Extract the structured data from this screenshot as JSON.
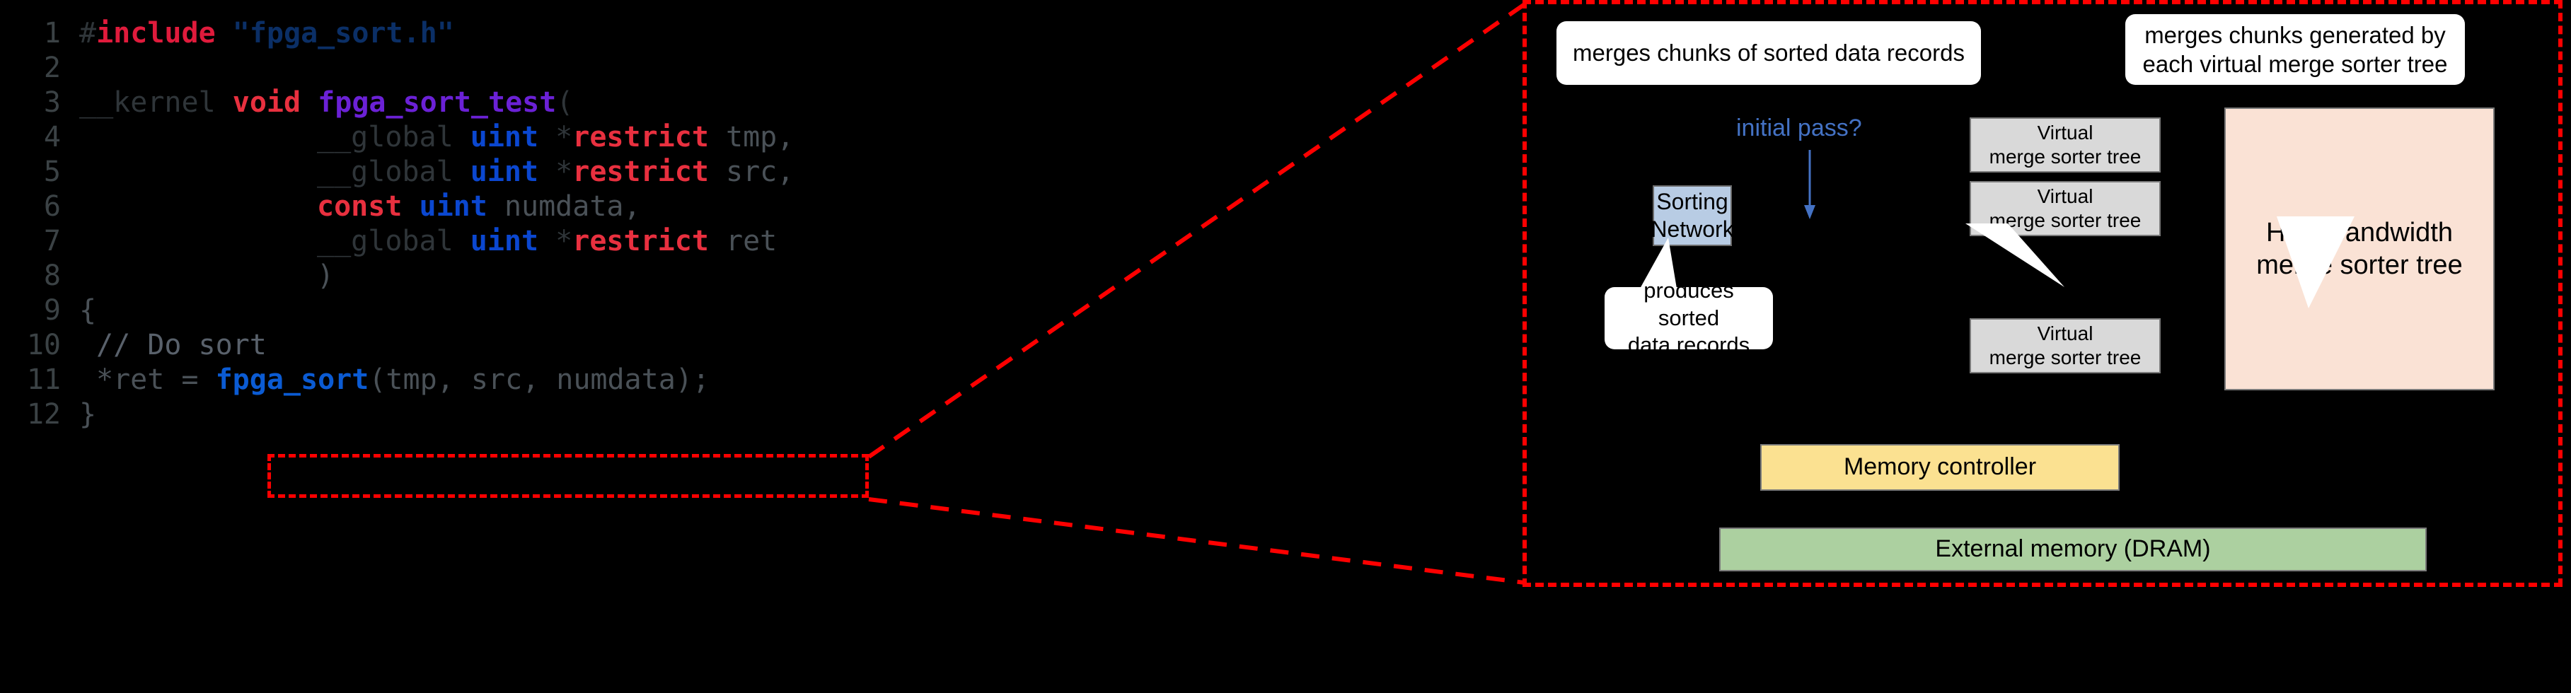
{
  "code": {
    "language": "OpenCL C",
    "lines": [
      {
        "num": "1",
        "tokens": [
          {
            "t": "#",
            "c": "plain"
          },
          {
            "t": "include",
            "c": "kw"
          },
          {
            "t": " ",
            "c": "plain"
          },
          {
            "t": "\"fpga_sort.h\"",
            "c": "str"
          }
        ]
      },
      {
        "num": "2",
        "tokens": []
      },
      {
        "num": "3",
        "tokens": [
          {
            "t": "__kernel",
            "c": "plain"
          },
          {
            "t": " ",
            "c": "plain"
          },
          {
            "t": "void",
            "c": "kw2"
          },
          {
            "t": " ",
            "c": "plain"
          },
          {
            "t": "fpga_sort_test",
            "c": "fn"
          },
          {
            "t": "(",
            "c": "punct"
          }
        ]
      },
      {
        "num": "4",
        "indent": 28,
        "tokens": [
          {
            "t": "__global",
            "c": "plain"
          },
          {
            "t": " ",
            "c": "plain"
          },
          {
            "t": "uint",
            "c": "type"
          },
          {
            "t": " *",
            "c": "plain"
          },
          {
            "t": "restrict",
            "c": "kw2"
          },
          {
            "t": " ",
            "c": "plain"
          },
          {
            "t": "tmp,",
            "c": "dim"
          }
        ]
      },
      {
        "num": "5",
        "indent": 28,
        "tokens": [
          {
            "t": "__global",
            "c": "plain"
          },
          {
            "t": " ",
            "c": "plain"
          },
          {
            "t": "uint",
            "c": "type"
          },
          {
            "t": " *",
            "c": "plain"
          },
          {
            "t": "restrict",
            "c": "kw2"
          },
          {
            "t": " ",
            "c": "plain"
          },
          {
            "t": "src,",
            "c": "dim"
          }
        ]
      },
      {
        "num": "6",
        "indent": 28,
        "tokens": [
          {
            "t": "const",
            "c": "kw2"
          },
          {
            "t": " ",
            "c": "plain"
          },
          {
            "t": "uint",
            "c": "type"
          },
          {
            "t": " ",
            "c": "plain"
          },
          {
            "t": "numdata,",
            "c": "dim"
          }
        ]
      },
      {
        "num": "7",
        "indent": 28,
        "tokens": [
          {
            "t": "__global",
            "c": "plain"
          },
          {
            "t": " ",
            "c": "plain"
          },
          {
            "t": "uint",
            "c": "type"
          },
          {
            "t": " *",
            "c": "plain"
          },
          {
            "t": "restrict",
            "c": "kw2"
          },
          {
            "t": " ",
            "c": "plain"
          },
          {
            "t": "ret",
            "c": "dim"
          }
        ]
      },
      {
        "num": "8",
        "indent": 28,
        "tokens": [
          {
            "t": ")",
            "c": "dim"
          }
        ]
      },
      {
        "num": "9",
        "tokens": [
          {
            "t": "{",
            "c": "dim"
          }
        ]
      },
      {
        "num": "10",
        "indent": 2,
        "tokens": [
          {
            "t": "// Do sort",
            "c": "comment"
          }
        ]
      },
      {
        "num": "11",
        "indent": 2,
        "tokens": [
          {
            "t": "*ret = ",
            "c": "dim"
          },
          {
            "t": "fpga_sort",
            "c": "call"
          },
          {
            "t": "(tmp, src, numdata);",
            "c": "dim"
          }
        ]
      },
      {
        "num": "12",
        "tokens": [
          {
            "t": "}",
            "c": "dim"
          }
        ]
      }
    ]
  },
  "highlight": {
    "target_call": "fpga_sort(tmp, src, numdata);",
    "border_color": "#ff0000",
    "style": "dashed"
  },
  "diagram": {
    "border_color": "#ff0000",
    "callouts": [
      {
        "id": "callout-merge-chunks",
        "text": "merges chunks of sorted data records"
      },
      {
        "id": "callout-merge-generated",
        "text": "merges chunks generated by\neach virtual merge sorter tree"
      },
      {
        "id": "callout-produces-sorted",
        "text": "produces sorted\ndata records"
      }
    ],
    "annotation": {
      "initial_pass_label": "initial pass?",
      "initial_pass_color": "#4472c4"
    },
    "nodes": {
      "sorting_network": {
        "label": "Sorting\nNetwork",
        "color": "#b8cce4"
      },
      "virtual_trees": [
        {
          "label": "Virtual\nmerge sorter tree",
          "color": "#d9d9d9"
        },
        {
          "label": "Virtual\nmerge sorter tree",
          "color": "#d9d9d9"
        },
        {
          "label": "Virtual\nmerge sorter tree",
          "color": "#d9d9d9"
        }
      ],
      "high_bandwidth_tree": {
        "label": "High-bandwidth\nmerge sorter tree",
        "color": "#fae2d5"
      },
      "memory_controller": {
        "label": "Memory controller",
        "color": "#fbe191"
      },
      "external_memory": {
        "label": "External memory (DRAM)",
        "color": "#acd0a0"
      }
    }
  }
}
